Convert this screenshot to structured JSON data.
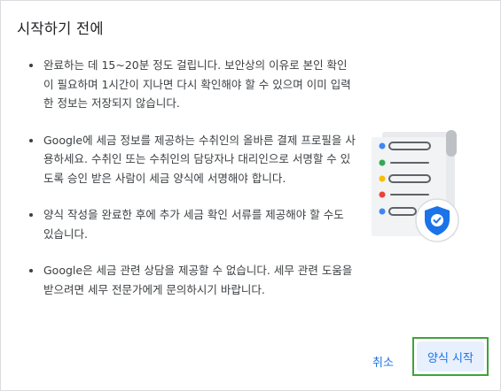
{
  "dialog": {
    "title": "시작하기 전에",
    "bullets": [
      "완료하는 데 15~20분 정도 걸립니다. 보안상의 이유로 본인 확인이 필요하며 1시간이 지나면 다시 확인해야 할 수 있으며 이미 입력한 정보는 저장되지 않습니다.",
      "Google에 세금 정보를 제공하는 수취인의 올바른 결제 프로필을 사용하세요. 수취인 또는 수취인의 담당자나 대리인으로 서명할 수 있도록 승인 받은 사람이 세금 양식에 서명해야 합니다.",
      "양식 작성을 완료한 후에 추가 세금 확인 서류를 제공해야 할 수도 있습니다.",
      "Google은 세금 관련 상담을 제공할 수 없습니다. 세무 관련 도움을 받으려면 세무 전문가에게 문의하시기 바랍니다."
    ],
    "illustration_icon": "document-with-shield-checkmark",
    "colors": {
      "accent": "#1a73e8",
      "start_button_bg": "#e8f0fe",
      "highlight_border": "#3fa33b",
      "dot_blue": "#4285f4",
      "dot_green": "#34a853",
      "dot_yellow": "#fbbc04",
      "dot_red": "#ea4335"
    },
    "buttons": {
      "cancel_label": "취소",
      "start_label": "양식 시작"
    }
  }
}
